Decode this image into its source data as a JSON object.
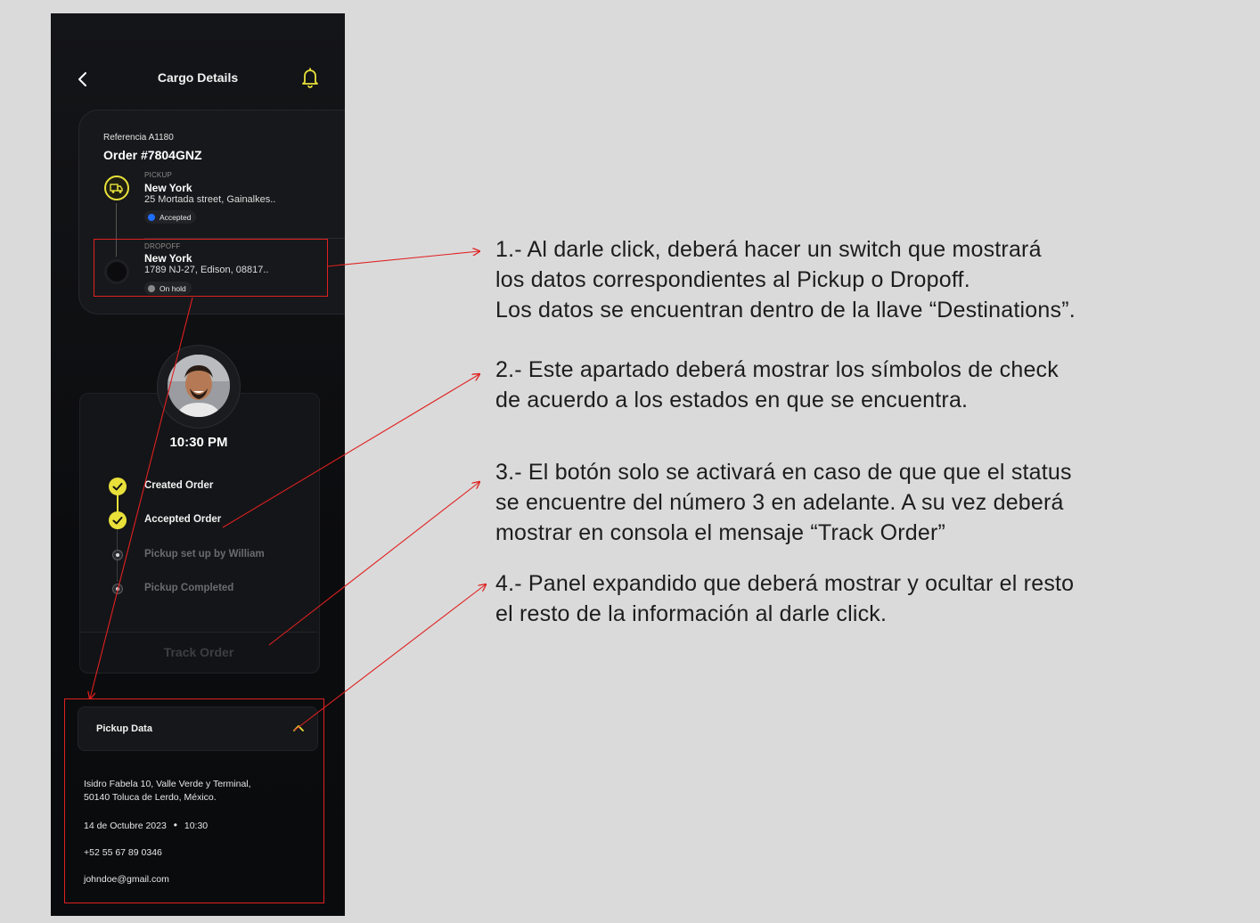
{
  "header": {
    "title": "Cargo Details"
  },
  "order": {
    "reference": "Referencia A1180",
    "number": "Order #7804GNZ",
    "pickup": {
      "tag": "PICKUP",
      "city": "New York",
      "address": "25 Mortada street, Gainalkes..",
      "status": "Accepted",
      "status_color": "#1f6fff"
    },
    "dropoff": {
      "tag": "DROPOFF",
      "city": "New York",
      "address": "1789 NJ-27, Edison, 08817..",
      "status": "On hold",
      "status_color": "#8a8a8a"
    }
  },
  "driver": {
    "time": "10:30 PM"
  },
  "steps": [
    {
      "label": "Created Order",
      "done": true
    },
    {
      "label": "Accepted Order",
      "done": true
    },
    {
      "label": "Pickup set up by William",
      "done": false
    },
    {
      "label": "Pickup Completed",
      "done": false
    }
  ],
  "track_button": {
    "label": "Track Order",
    "enabled": false
  },
  "pickup_panel": {
    "title": "Pickup Data",
    "expanded": true,
    "address_line1": "Isidro Fabela 10, Valle Verde  y Terminal,",
    "address_line2": "50140 Toluca de Lerdo, México.",
    "date": "14 de Octubre 2023",
    "time": "10:30",
    "phone": "+52 55 67 89 0346",
    "email": "johndoe@gmail.com"
  },
  "notes": [
    {
      "lines": [
        "1.- Al darle click, deberá hacer un switch que mostrará",
        "los datos correspondientes al Pickup o Dropoff.",
        "Los datos se encuentran dentro de la llave “Destinations”."
      ]
    },
    {
      "lines": [
        "2.- Este apartado deberá mostrar los símbolos de check",
        "de acuerdo a los estados en que se encuentra."
      ]
    },
    {
      "lines": [
        "3.- El botón solo se activará en caso de que que el status",
        "se encuentre del número 3 en adelante. A su vez deberá",
        "mostrar en consola el mensaje “Track Order”"
      ]
    },
    {
      "lines": [
        "4.- Panel expandido que deberá mostrar  y ocultar el resto",
        "el resto de la información al darle click."
      ]
    }
  ],
  "colors": {
    "accent": "#e9e13a",
    "annotation": "#e02020",
    "background": "#0b0c0e"
  },
  "icons": {
    "back": "chevron-left-icon",
    "bell": "bell-icon",
    "pickup": "truck-icon",
    "check": "check-icon",
    "panel_toggle": "chevron-up-icon",
    "avatar": "driver-photo"
  }
}
